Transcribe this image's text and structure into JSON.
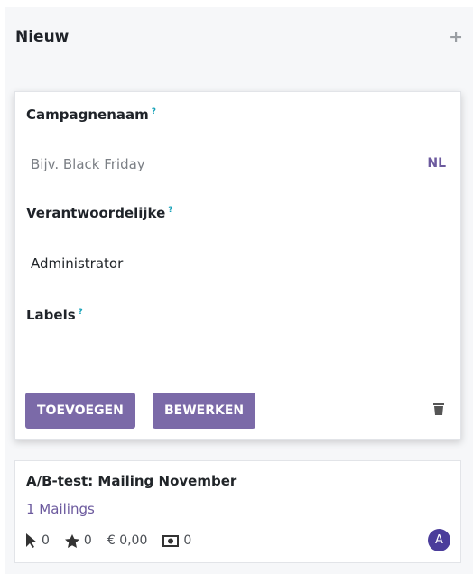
{
  "column": {
    "title": "Nieuw"
  },
  "quick_create": {
    "campaign_label": "Campagnenaam",
    "help": "?",
    "campaign_placeholder": "Bijv. Black Friday",
    "lang": "NL",
    "responsible_label": "Verantwoordelijke",
    "responsible_value": "Administrator",
    "labels_label": "Labels",
    "add_button": "TOEVOEGEN",
    "edit_button": "BEWERKEN"
  },
  "card": {
    "title": "A/B-test: Mailing November",
    "mailings": "1 Mailings",
    "clicks": "0",
    "stars": "0",
    "revenue": "€ 0,00",
    "money": "0",
    "avatar": "A"
  },
  "colors": {
    "accent": "#7b6aa8",
    "avatar": "#4b3d9b",
    "help": "#17a2b8"
  }
}
